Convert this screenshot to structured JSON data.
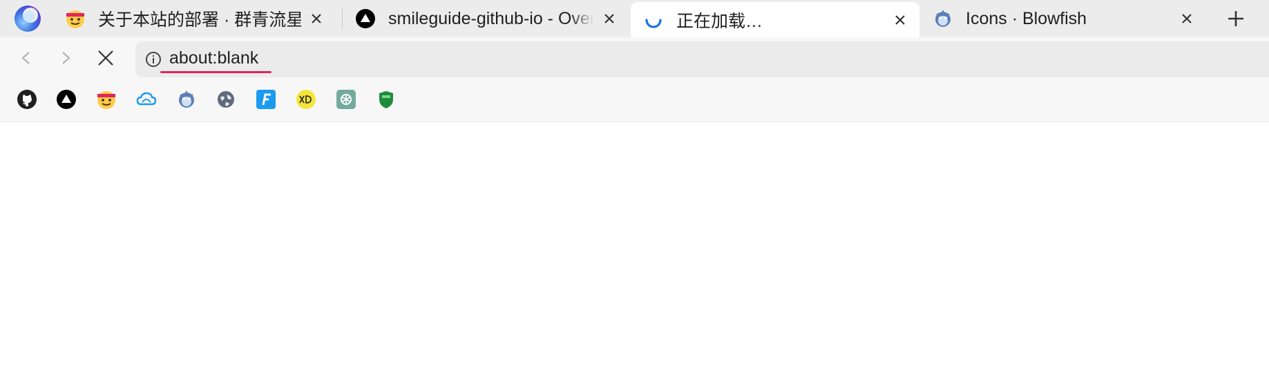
{
  "tabs": [
    {
      "title": "关于本站的部署 · 群青流星",
      "favicon": "smiley-ninja-icon",
      "active": false
    },
    {
      "title": "smileguide-github-io - Overview",
      "favicon": "vercel-triangle-icon",
      "active": false
    },
    {
      "title": "正在加载…",
      "favicon": "loading-spinner-icon",
      "active": true
    },
    {
      "title": "Icons · Blowfish",
      "favicon": "blowfish-icon",
      "active": false
    }
  ],
  "address_bar": {
    "url": "about:blank"
  },
  "bookmarks": [
    {
      "icon": "github-icon"
    },
    {
      "icon": "vercel-icon"
    },
    {
      "icon": "smiley-ninja-icon"
    },
    {
      "icon": "cloud-icon"
    },
    {
      "icon": "blowfish-icon"
    },
    {
      "icon": "globe-icon"
    },
    {
      "icon": "f-logo-icon"
    },
    {
      "icon": "xd-icon"
    },
    {
      "icon": "openai-icon"
    },
    {
      "icon": "shield-icon"
    }
  ],
  "colors": {
    "accent": "#1a73e8",
    "underline": "#e0245e",
    "tabbar_bg": "#ececec",
    "toolbar_bg": "#f7f7f7"
  }
}
